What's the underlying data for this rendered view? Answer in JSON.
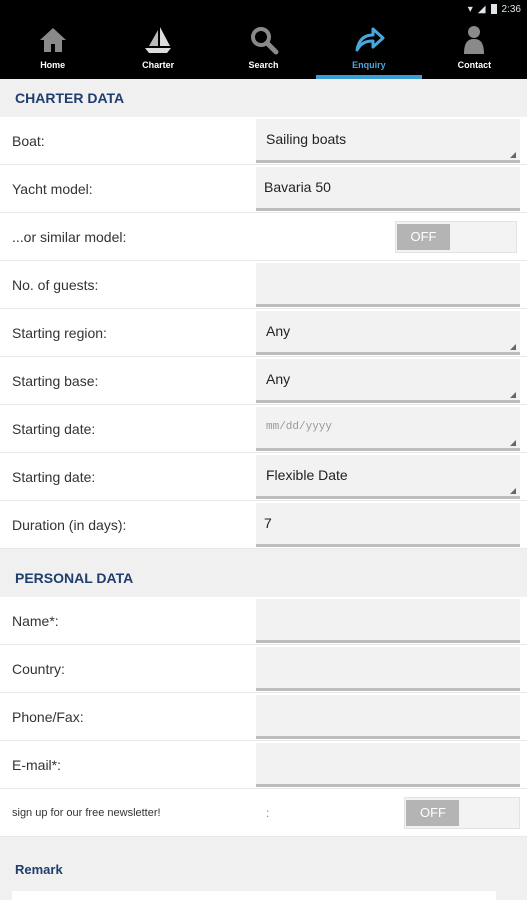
{
  "status": {
    "time": "2:36"
  },
  "nav": {
    "items": [
      {
        "label": "Home",
        "icon": "home-icon"
      },
      {
        "label": "Charter",
        "icon": "sailboat-icon"
      },
      {
        "label": "Search",
        "icon": "search-icon"
      },
      {
        "label": "Enquiry",
        "icon": "share-arrow-icon",
        "active": true
      },
      {
        "label": "Contact",
        "icon": "person-icon"
      }
    ]
  },
  "charter": {
    "title": "CHARTER DATA",
    "boat": {
      "label": "Boat:",
      "value": "Sailing boats"
    },
    "yacht_model": {
      "label": "Yacht model:",
      "value": "Bavaria 50"
    },
    "similar": {
      "label": "...or similar model:",
      "toggle": "OFF"
    },
    "guests": {
      "label": "No. of guests:",
      "value": ""
    },
    "region": {
      "label": "Starting region:",
      "value": "Any"
    },
    "base": {
      "label": "Starting base:",
      "value": "Any"
    },
    "date1": {
      "label": "Starting date:",
      "placeholder": "mm/dd/yyyy"
    },
    "date2": {
      "label": "Starting date:",
      "value": "Flexible Date"
    },
    "duration": {
      "label": "Duration (in days):",
      "value": "7"
    }
  },
  "personal": {
    "title": "PERSONAL DATA",
    "name": {
      "label": "Name*:",
      "value": ""
    },
    "country": {
      "label": "Country:",
      "value": ""
    },
    "phone": {
      "label": "Phone/Fax:",
      "value": ""
    },
    "email": {
      "label": "E-mail*:",
      "value": ""
    },
    "newsletter": {
      "label": "sign up for our free newsletter!",
      "colon": ":",
      "toggle": "OFF"
    }
  },
  "remark": {
    "title": "Remark"
  },
  "colors": {
    "accent": "#3b9cd6",
    "heading": "#1f3e6e",
    "toggle_off": "#b4b4b4"
  }
}
